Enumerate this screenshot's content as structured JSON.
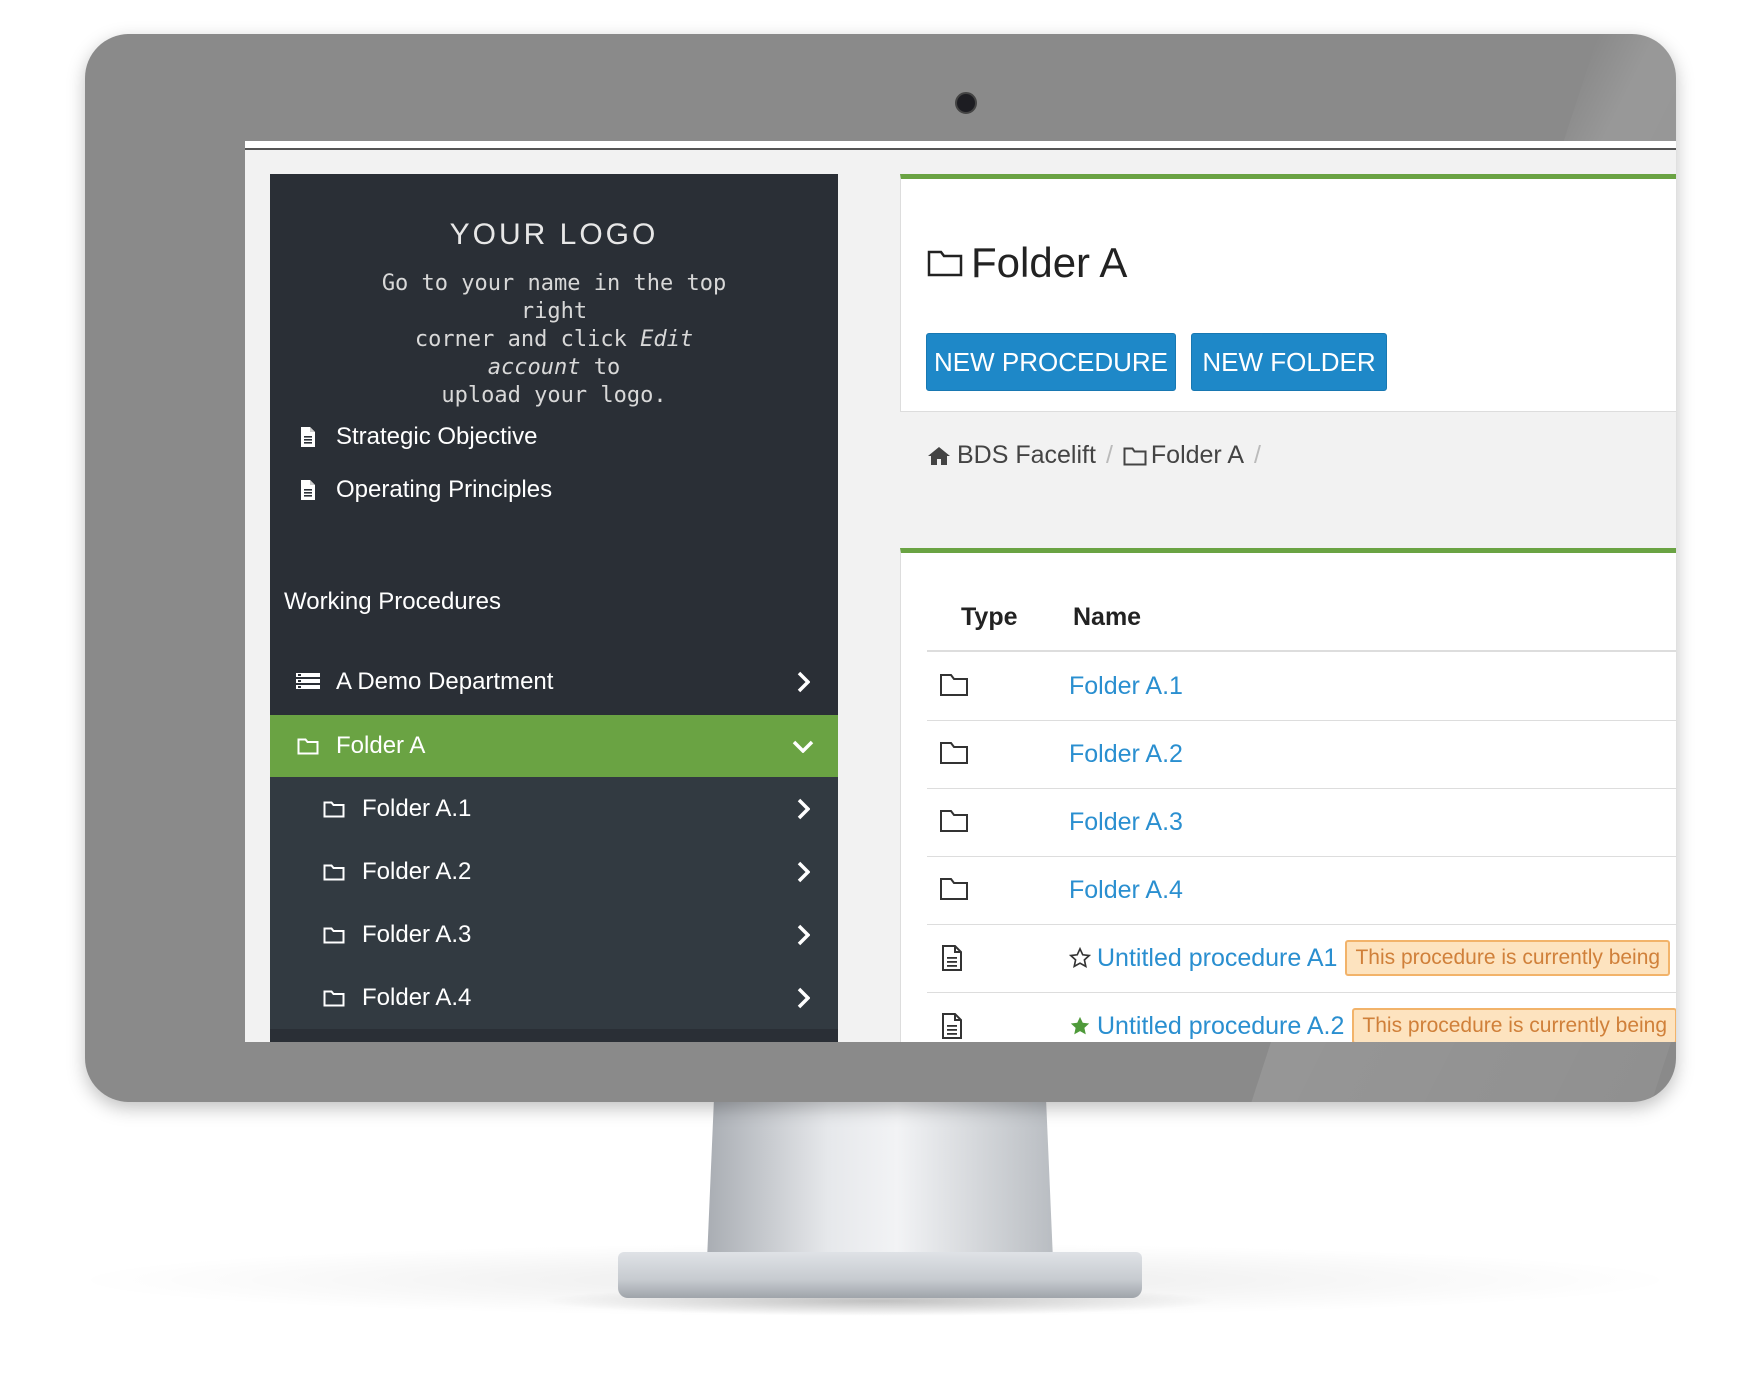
{
  "sidebar": {
    "logo_title": "YOUR LOGO",
    "logo_line1": "Go to your name in the top right",
    "logo_line2_pre": "corner and click ",
    "logo_line2_em": "Edit account",
    "logo_line2_post": " to",
    "logo_line3": "upload your logo.",
    "items": [
      {
        "label": "Strategic Objective",
        "icon": "document-icon"
      },
      {
        "label": "Operating Principles",
        "icon": "document-icon"
      }
    ],
    "section_label": "Working Procedures",
    "department": {
      "label": "A Demo Department",
      "icon": "department-icon"
    },
    "active_folder": {
      "label": "Folder A",
      "icon": "folder-icon"
    },
    "subfolders": [
      "Folder A.1",
      "Folder A.2",
      "Folder A.3",
      "Folder A.4"
    ]
  },
  "main": {
    "title": "Folder A",
    "buttons": {
      "new_procedure": "NEW PROCEDURE",
      "new_folder": "NEW FOLDER"
    },
    "breadcrumb": {
      "home": "BDS Facelift",
      "folder": "Folder A",
      "sep": "/"
    },
    "table": {
      "columns": [
        "Type",
        "Name"
      ],
      "rows": [
        {
          "type": "folder",
          "name": "Folder A.1"
        },
        {
          "type": "folder",
          "name": "Folder A.2"
        },
        {
          "type": "folder",
          "name": "Folder A.3"
        },
        {
          "type": "folder",
          "name": "Folder A.4"
        },
        {
          "type": "procedure",
          "name": "Untitled procedure A1",
          "starred": false,
          "badge": "This procedure is currently being"
        },
        {
          "type": "procedure",
          "name": "Untitled procedure A.2",
          "starred": true,
          "badge": "This procedure is currently being"
        }
      ]
    }
  },
  "colors": {
    "sidebar_bg": "#2a2f36",
    "accent_green": "#6aa343",
    "button_blue": "#1e88c8",
    "link_blue": "#2a8fd0",
    "badge_bg": "#fde3bf"
  }
}
